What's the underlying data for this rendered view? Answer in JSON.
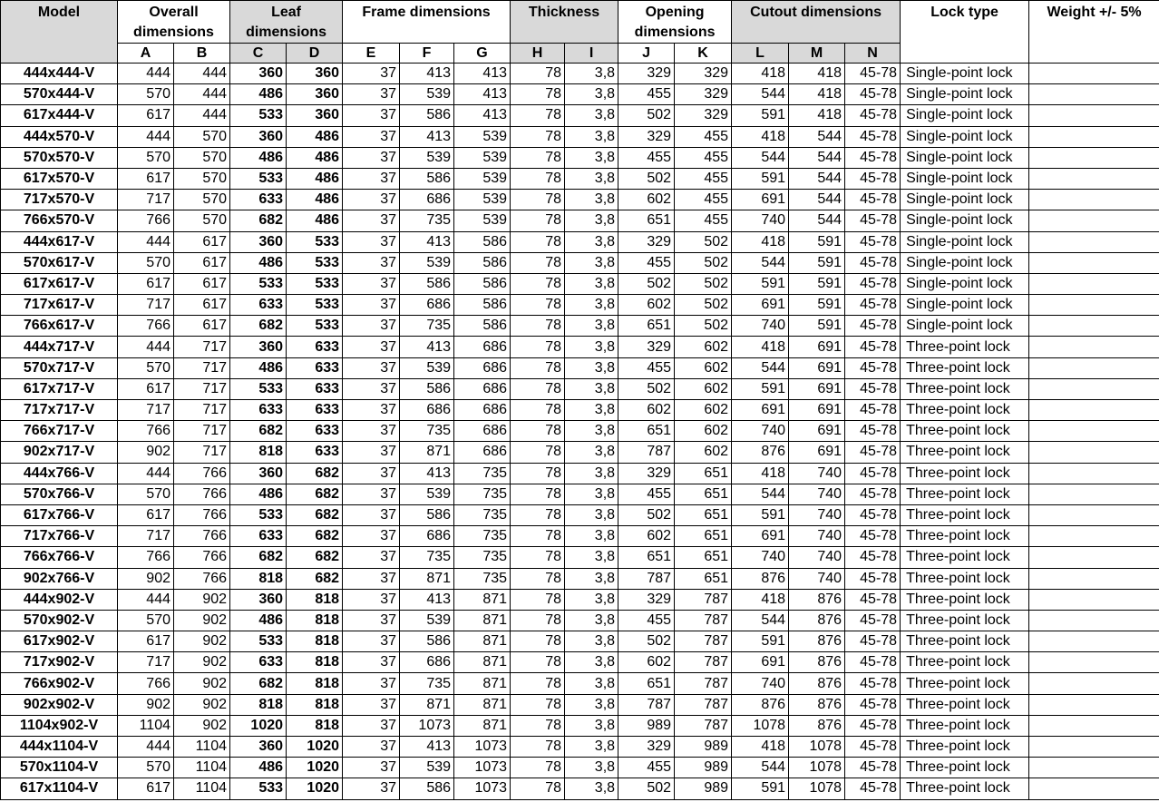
{
  "headers": {
    "model": "Model",
    "overall": "Overall dimensions",
    "leaf": "Leaf dimensions",
    "frame": "Frame dimensions",
    "thickness": "Thickness",
    "opening": "Opening dimensions",
    "cutout": "Cutout dimensions",
    "lock": "Lock type",
    "weight": "Weight +/- 5%",
    "letters": [
      "A",
      "B",
      "C",
      "D",
      "E",
      "F",
      "G",
      "H",
      "I",
      "J",
      "K",
      "L",
      "M",
      "N"
    ]
  },
  "rows": [
    [
      "444x444-V",
      "444",
      "444",
      "360",
      "360",
      "37",
      "413",
      "413",
      "78",
      "3,8",
      "329",
      "329",
      "418",
      "418",
      "45-78",
      "Single-point lock",
      ""
    ],
    [
      "570x444-V",
      "570",
      "444",
      "486",
      "360",
      "37",
      "539",
      "413",
      "78",
      "3,8",
      "455",
      "329",
      "544",
      "418",
      "45-78",
      "Single-point lock",
      ""
    ],
    [
      "617x444-V",
      "617",
      "444",
      "533",
      "360",
      "37",
      "586",
      "413",
      "78",
      "3,8",
      "502",
      "329",
      "591",
      "418",
      "45-78",
      "Single-point lock",
      ""
    ],
    [
      "444x570-V",
      "444",
      "570",
      "360",
      "486",
      "37",
      "413",
      "539",
      "78",
      "3,8",
      "329",
      "455",
      "418",
      "544",
      "45-78",
      "Single-point lock",
      ""
    ],
    [
      "570x570-V",
      "570",
      "570",
      "486",
      "486",
      "37",
      "539",
      "539",
      "78",
      "3,8",
      "455",
      "455",
      "544",
      "544",
      "45-78",
      "Single-point lock",
      ""
    ],
    [
      "617x570-V",
      "617",
      "570",
      "533",
      "486",
      "37",
      "586",
      "539",
      "78",
      "3,8",
      "502",
      "455",
      "591",
      "544",
      "45-78",
      "Single-point lock",
      ""
    ],
    [
      "717x570-V",
      "717",
      "570",
      "633",
      "486",
      "37",
      "686",
      "539",
      "78",
      "3,8",
      "602",
      "455",
      "691",
      "544",
      "45-78",
      "Single-point lock",
      ""
    ],
    [
      "766x570-V",
      "766",
      "570",
      "682",
      "486",
      "37",
      "735",
      "539",
      "78",
      "3,8",
      "651",
      "455",
      "740",
      "544",
      "45-78",
      "Single-point lock",
      ""
    ],
    [
      "444x617-V",
      "444",
      "617",
      "360",
      "533",
      "37",
      "413",
      "586",
      "78",
      "3,8",
      "329",
      "502",
      "418",
      "591",
      "45-78",
      "Single-point lock",
      ""
    ],
    [
      "570x617-V",
      "570",
      "617",
      "486",
      "533",
      "37",
      "539",
      "586",
      "78",
      "3,8",
      "455",
      "502",
      "544",
      "591",
      "45-78",
      "Single-point lock",
      ""
    ],
    [
      "617x617-V",
      "617",
      "617",
      "533",
      "533",
      "37",
      "586",
      "586",
      "78",
      "3,8",
      "502",
      "502",
      "591",
      "591",
      "45-78",
      "Single-point lock",
      ""
    ],
    [
      "717x617-V",
      "717",
      "617",
      "633",
      "533",
      "37",
      "686",
      "586",
      "78",
      "3,8",
      "602",
      "502",
      "691",
      "591",
      "45-78",
      "Single-point lock",
      ""
    ],
    [
      "766x617-V",
      "766",
      "617",
      "682",
      "533",
      "37",
      "735",
      "586",
      "78",
      "3,8",
      "651",
      "502",
      "740",
      "591",
      "45-78",
      "Single-point lock",
      ""
    ],
    [
      "444x717-V",
      "444",
      "717",
      "360",
      "633",
      "37",
      "413",
      "686",
      "78",
      "3,8",
      "329",
      "602",
      "418",
      "691",
      "45-78",
      "Three-point lock",
      ""
    ],
    [
      "570x717-V",
      "570",
      "717",
      "486",
      "633",
      "37",
      "539",
      "686",
      "78",
      "3,8",
      "455",
      "602",
      "544",
      "691",
      "45-78",
      "Three-point lock",
      ""
    ],
    [
      "617x717-V",
      "617",
      "717",
      "533",
      "633",
      "37",
      "586",
      "686",
      "78",
      "3,8",
      "502",
      "602",
      "591",
      "691",
      "45-78",
      "Three-point lock",
      ""
    ],
    [
      "717x717-V",
      "717",
      "717",
      "633",
      "633",
      "37",
      "686",
      "686",
      "78",
      "3,8",
      "602",
      "602",
      "691",
      "691",
      "45-78",
      "Three-point lock",
      ""
    ],
    [
      "766x717-V",
      "766",
      "717",
      "682",
      "633",
      "37",
      "735",
      "686",
      "78",
      "3,8",
      "651",
      "602",
      "740",
      "691",
      "45-78",
      "Three-point lock",
      ""
    ],
    [
      "902x717-V",
      "902",
      "717",
      "818",
      "633",
      "37",
      "871",
      "686",
      "78",
      "3,8",
      "787",
      "602",
      "876",
      "691",
      "45-78",
      "Three-point lock",
      ""
    ],
    [
      "444x766-V",
      "444",
      "766",
      "360",
      "682",
      "37",
      "413",
      "735",
      "78",
      "3,8",
      "329",
      "651",
      "418",
      "740",
      "45-78",
      "Three-point lock",
      ""
    ],
    [
      "570x766-V",
      "570",
      "766",
      "486",
      "682",
      "37",
      "539",
      "735",
      "78",
      "3,8",
      "455",
      "651",
      "544",
      "740",
      "45-78",
      "Three-point lock",
      ""
    ],
    [
      "617x766-V",
      "617",
      "766",
      "533",
      "682",
      "37",
      "586",
      "735",
      "78",
      "3,8",
      "502",
      "651",
      "591",
      "740",
      "45-78",
      "Three-point lock",
      ""
    ],
    [
      "717x766-V",
      "717",
      "766",
      "633",
      "682",
      "37",
      "686",
      "735",
      "78",
      "3,8",
      "602",
      "651",
      "691",
      "740",
      "45-78",
      "Three-point lock",
      ""
    ],
    [
      "766x766-V",
      "766",
      "766",
      "682",
      "682",
      "37",
      "735",
      "735",
      "78",
      "3,8",
      "651",
      "651",
      "740",
      "740",
      "45-78",
      "Three-point lock",
      ""
    ],
    [
      "902x766-V",
      "902",
      "766",
      "818",
      "682",
      "37",
      "871",
      "735",
      "78",
      "3,8",
      "787",
      "651",
      "876",
      "740",
      "45-78",
      "Three-point lock",
      ""
    ],
    [
      "444x902-V",
      "444",
      "902",
      "360",
      "818",
      "37",
      "413",
      "871",
      "78",
      "3,8",
      "329",
      "787",
      "418",
      "876",
      "45-78",
      "Three-point lock",
      ""
    ],
    [
      "570x902-V",
      "570",
      "902",
      "486",
      "818",
      "37",
      "539",
      "871",
      "78",
      "3,8",
      "455",
      "787",
      "544",
      "876",
      "45-78",
      "Three-point lock",
      ""
    ],
    [
      "617x902-V",
      "617",
      "902",
      "533",
      "818",
      "37",
      "586",
      "871",
      "78",
      "3,8",
      "502",
      "787",
      "591",
      "876",
      "45-78",
      "Three-point lock",
      ""
    ],
    [
      "717x902-V",
      "717",
      "902",
      "633",
      "818",
      "37",
      "686",
      "871",
      "78",
      "3,8",
      "602",
      "787",
      "691",
      "876",
      "45-78",
      "Three-point lock",
      ""
    ],
    [
      "766x902-V",
      "766",
      "902",
      "682",
      "818",
      "37",
      "735",
      "871",
      "78",
      "3,8",
      "651",
      "787",
      "740",
      "876",
      "45-78",
      "Three-point lock",
      ""
    ],
    [
      "902x902-V",
      "902",
      "902",
      "818",
      "818",
      "37",
      "871",
      "871",
      "78",
      "3,8",
      "787",
      "787",
      "876",
      "876",
      "45-78",
      "Three-point lock",
      ""
    ],
    [
      "1104x902-V",
      "1104",
      "902",
      "1020",
      "818",
      "37",
      "1073",
      "871",
      "78",
      "3,8",
      "989",
      "787",
      "1078",
      "876",
      "45-78",
      "Three-point lock",
      ""
    ],
    [
      "444x1104-V",
      "444",
      "1104",
      "360",
      "1020",
      "37",
      "413",
      "1073",
      "78",
      "3,8",
      "329",
      "989",
      "418",
      "1078",
      "45-78",
      "Three-point lock",
      ""
    ],
    [
      "570x1104-V",
      "570",
      "1104",
      "486",
      "1020",
      "37",
      "539",
      "1073",
      "78",
      "3,8",
      "455",
      "989",
      "544",
      "1078",
      "45-78",
      "Three-point lock",
      ""
    ],
    [
      "617x1104-V",
      "617",
      "1104",
      "533",
      "1020",
      "37",
      "586",
      "1073",
      "78",
      "3,8",
      "502",
      "989",
      "591",
      "1078",
      "45-78",
      "Three-point lock",
      ""
    ]
  ]
}
